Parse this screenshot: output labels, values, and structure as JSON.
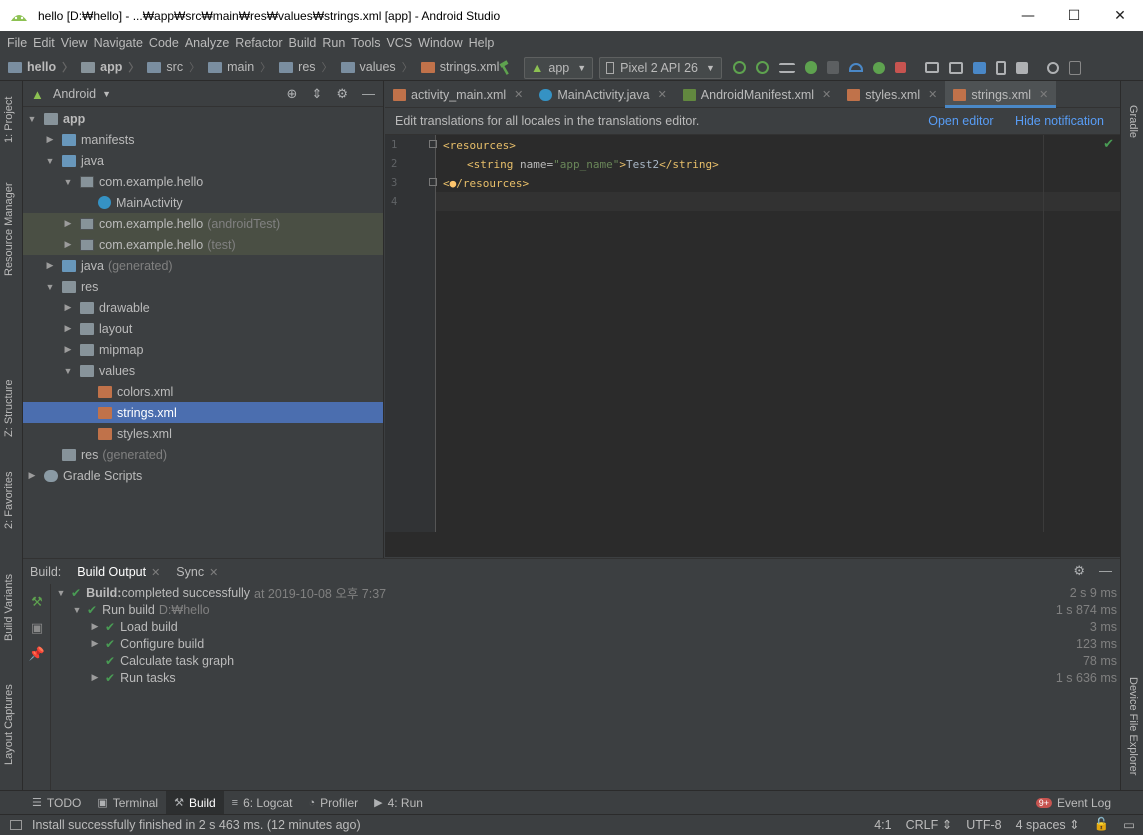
{
  "window": {
    "title": "hello [D:₩hello] - ...₩app₩src₩main₩res₩values₩strings.xml [app] - Android Studio",
    "minimize": "—",
    "maximize": "☐",
    "close": "✕"
  },
  "menu": [
    "File",
    "Edit",
    "View",
    "Navigate",
    "Code",
    "Analyze",
    "Refactor",
    "Build",
    "Run",
    "Tools",
    "VCS",
    "Window",
    "Help"
  ],
  "breadcrumbs": [
    "hello",
    "app",
    "src",
    "main",
    "res",
    "values",
    "strings.xml"
  ],
  "toolbar": {
    "run_config": "app",
    "device": "Pixel 2 API 26"
  },
  "left_strip": {
    "project": "1: Project",
    "resource_manager": "Resource Manager",
    "structure": "Z: Structure",
    "favorites": "2: Favorites",
    "build_variants": "Build Variants",
    "layout_captures": "Layout Captures"
  },
  "right_strip": {
    "gradle": "Gradle",
    "device_file_explorer": "Device File Explorer"
  },
  "project_panel": {
    "view": "Android",
    "tree": [
      {
        "label": "app",
        "extra": ""
      },
      {
        "label": "manifests",
        "extra": ""
      },
      {
        "label": "java",
        "extra": ""
      },
      {
        "label": "com.example.hello",
        "extra": ""
      },
      {
        "label": "MainActivity",
        "extra": ""
      },
      {
        "label": "com.example.hello",
        "extra": "(androidTest)"
      },
      {
        "label": "com.example.hello",
        "extra": "(test)"
      },
      {
        "label": "java",
        "extra": "(generated)"
      },
      {
        "label": "res",
        "extra": ""
      },
      {
        "label": "drawable",
        "extra": ""
      },
      {
        "label": "layout",
        "extra": ""
      },
      {
        "label": "mipmap",
        "extra": ""
      },
      {
        "label": "values",
        "extra": ""
      },
      {
        "label": "colors.xml",
        "extra": ""
      },
      {
        "label": "strings.xml",
        "extra": ""
      },
      {
        "label": "styles.xml",
        "extra": ""
      },
      {
        "label": "res",
        "extra": "(generated)"
      },
      {
        "label": "Gradle Scripts",
        "extra": ""
      }
    ]
  },
  "editor": {
    "tabs": [
      "activity_main.xml",
      "MainActivity.java",
      "AndroidManifest.xml",
      "styles.xml",
      "strings.xml"
    ],
    "active_tab": "strings.xml",
    "notification": "Edit translations for all locales in the translations editor.",
    "open_editor": "Open editor",
    "hide_notification": "Hide notification",
    "line_numbers": [
      "1",
      "2",
      "3",
      "4"
    ],
    "code": {
      "line1_tag": "<resources>",
      "line2_open": "<string ",
      "line2_attr": "name=",
      "line2_val": "\"app_name\"",
      "line2_gt": ">",
      "line2_text": "Test2",
      "line2_close": "</string>",
      "line3_a": "<",
      "line3_b": "/resources>"
    }
  },
  "build": {
    "label": "Build:",
    "tabs": [
      "Build Output",
      "Sync"
    ],
    "rows": [
      {
        "bold": "Build:",
        "text": " completed successfully",
        "extra": "at 2019-10-08 오후 7:37",
        "duration": "2 s 9 ms"
      },
      {
        "bold": "",
        "text": "Run build",
        "extra": "D:₩hello",
        "duration": "1 s 874 ms"
      },
      {
        "bold": "",
        "text": "Load build",
        "extra": "",
        "duration": "3 ms"
      },
      {
        "bold": "",
        "text": "Configure build",
        "extra": "",
        "duration": "123 ms"
      },
      {
        "bold": "",
        "text": "Calculate task graph",
        "extra": "",
        "duration": "78 ms"
      },
      {
        "bold": "",
        "text": "Run tasks",
        "extra": "",
        "duration": "1 s 636 ms"
      }
    ]
  },
  "bottom_tools": [
    "TODO",
    "Terminal",
    "Build",
    "6: Logcat",
    "Profiler",
    "4: Run"
  ],
  "event_log": {
    "badge": "9+",
    "label": "Event Log"
  },
  "status": {
    "message": "Install successfully finished in 2 s 463 ms. (12 minutes ago)",
    "position": "4:1",
    "line_sep": "CRLF ⇕",
    "encoding": "UTF-8",
    "indent": "4 spaces ⇕"
  },
  "colors": {
    "selection": "#4b6eaf",
    "tab_underline": "#4a88c7",
    "success": "#499c54",
    "link": "#589df6"
  }
}
